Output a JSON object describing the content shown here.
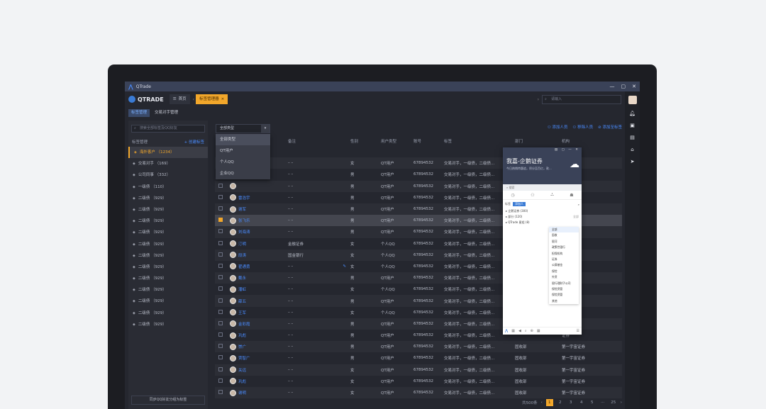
{
  "window": {
    "app_name": "QTrade",
    "brand": "QTRADE",
    "buttons": [
      "—",
      "▢",
      "✕"
    ]
  },
  "top": {
    "tabs": [
      {
        "label": "首页",
        "icon": "menu-icon"
      },
      {
        "label": "标签管理器",
        "close": "×"
      }
    ],
    "search_placeholder": "请输入"
  },
  "subtabs": [
    "标签管理",
    "交易对手管理"
  ],
  "sidebar": {
    "search_placeholder": "搜索全部标签及QQ好友",
    "header": "标签管理",
    "add_label": "+ 创建标签",
    "items": [
      "海外客户 （1234）",
      "交易对手 （169）",
      "公司同事 （332）",
      "一级债 （110）",
      "二级债 （929）",
      "二级债 （929）",
      "二级债 （929）",
      "二级债 （929）",
      "二级债 （929）",
      "二级债 （929）",
      "二级债 （929）",
      "二级债 （929）",
      "二级债 （929）",
      "二级债 （929）",
      "二级债 （929）",
      "二级债 （929）"
    ],
    "footer": "同步QQ好友分组为标签"
  },
  "filter": {
    "value": "全部类型",
    "options": [
      "全部类型",
      "QT用户",
      "个人QQ",
      "企业QQ"
    ]
  },
  "actions": [
    "添加人员",
    "移除人员",
    "添加至标签"
  ],
  "columns": [
    "",
    "",
    "备注",
    "性别",
    "用户类型",
    "账号",
    "标签",
    "部门",
    "机构"
  ],
  "rows": [
    {
      "name": "",
      "note": "",
      "sex": "",
      "src": "",
      "acct": "",
      "tags": "",
      "dept": "",
      "org": ""
    },
    {
      "name": "",
      "note": "– –",
      "sex": "女",
      "src": "QT用户",
      "acct": "67894532",
      "tags": "交易对手，一级债，二级债...",
      "dept": "",
      "org": ""
    },
    {
      "name": "",
      "note": "– –",
      "sex": "男",
      "src": "QT用户",
      "acct": "67894532",
      "tags": "交易对手，一级债，二级债...",
      "dept": "",
      "org": ""
    },
    {
      "name": "",
      "note": "– –",
      "sex": "男",
      "src": "QT用户",
      "acct": "67894532",
      "tags": "交易对手，一级债，二级债...",
      "dept": "",
      "org": ""
    },
    {
      "name": "雷浩宇",
      "note": "– –",
      "sex": "男",
      "src": "QT用户",
      "acct": "67894532",
      "tags": "交易对手，一级债，二级债...",
      "dept": "",
      "org": "证券"
    },
    {
      "name": "谢军",
      "note": "– –",
      "sex": "男",
      "src": "QT用户",
      "acct": "67894532",
      "tags": "交易对手，一级债，二级债...",
      "dept": "",
      "org": "证券"
    },
    {
      "name": "张飞乐",
      "note": "– –",
      "sex": "男",
      "src": "QT用户",
      "acct": "67894532",
      "tags": "交易对手，一级债，二级债...",
      "dept": "",
      "org": "证券",
      "checked": true
    },
    {
      "name": "刘海涛",
      "note": "– –",
      "sex": "男",
      "src": "QT用户",
      "acct": "67894532",
      "tags": "交易对手，一级债，二级债...",
      "dept": "",
      "org": "证券"
    },
    {
      "name": "汀明",
      "note": "金融证券",
      "sex": "女",
      "src": "个人QQ",
      "acct": "67894532",
      "tags": "交易对手，一级债，二级债...",
      "dept": "",
      "org": ""
    },
    {
      "name": "段涛",
      "note": "国金银行",
      "sex": "女",
      "src": "个人QQ",
      "acct": "67894532",
      "tags": "交易对手，一级债，二级债...",
      "dept": "",
      "org": ""
    },
    {
      "name": "翟通勇",
      "note": "– –",
      "sex": "女",
      "src": "个人QQ",
      "acct": "67894532",
      "tags": "交易对手，一级债，二级债...",
      "dept": "",
      "org": "证券",
      "edit": true
    },
    {
      "name": "戴永",
      "note": "– –",
      "sex": "男",
      "src": "QT用户",
      "acct": "67894532",
      "tags": "交易对手，一级债，二级债...",
      "dept": "",
      "org": "证券"
    },
    {
      "name": "潘虹",
      "note": "– –",
      "sex": "女",
      "src": "个人QQ",
      "acct": "67894532",
      "tags": "交易对手，一级债，二级债...",
      "dept": "",
      "org": ""
    },
    {
      "name": "薛五",
      "note": "– –",
      "sex": "男",
      "src": "QT用户",
      "acct": "67894532",
      "tags": "交易对手，一级债，二级债...",
      "dept": "",
      "org": "证券"
    },
    {
      "name": "王军",
      "note": "– –",
      "sex": "女",
      "src": "个人QQ",
      "acct": "67894532",
      "tags": "交易对手，一级债，二级债...",
      "dept": "",
      "org": ""
    },
    {
      "name": "金彩霞",
      "note": "– –",
      "sex": "男",
      "src": "QT用户",
      "acct": "67894532",
      "tags": "交易对手，一级债，二级债...",
      "dept": "",
      "org": "证券"
    },
    {
      "name": "巩彪",
      "note": "– –",
      "sex": "男",
      "src": "QT用户",
      "acct": "67894532",
      "tags": "交易对手，一级债，二级债...",
      "dept": "",
      "org": "证券"
    },
    {
      "name": "崇广",
      "note": "– –",
      "sex": "男",
      "src": "QT用户",
      "acct": "67894532",
      "tags": "交易对手，一级债，二级债...",
      "dept": "固收部",
      "org": "第一宇宙证券"
    },
    {
      "name": "贾智广",
      "note": "– –",
      "sex": "男",
      "src": "QT用户",
      "acct": "67894532",
      "tags": "交易对手，一级债，二级债...",
      "dept": "固收部",
      "org": "第一宇宙证券"
    },
    {
      "name": "关远",
      "note": "– –",
      "sex": "女",
      "src": "QT用户",
      "acct": "67894532",
      "tags": "交易对手，一级债，二级债...",
      "dept": "固收部",
      "org": "第一宇宙证券"
    },
    {
      "name": "巩彪",
      "note": "– –",
      "sex": "女",
      "src": "QT用户",
      "acct": "67894532",
      "tags": "交易对手，一级债，二级债...",
      "dept": "固收部",
      "org": "第一宇宙证券"
    },
    {
      "name": "谢明",
      "note": "– –",
      "sex": "女",
      "src": "QT用户",
      "acct": "67894532",
      "tags": "交易对手，一级债，二级债...",
      "dept": "固收部",
      "org": "第一宇宙证券"
    }
  ],
  "pager": {
    "total": "共500条",
    "pages": [
      "1",
      "2",
      "3",
      "4",
      "5",
      "···",
      "25"
    ],
    "prev": "‹",
    "next": "›"
  },
  "popup": {
    "title": "我嘉-企鹅证券",
    "subtitle": "今日热销特惠追，积分至百亿，款...",
    "search": "搜索",
    "chip_left": "标签",
    "chip": "添加人",
    "tree": [
      "▸ 企鹅证券 (300)",
      "▸ 部分 (120)",
      "▸ QTrade 星组 (8)"
    ],
    "tree_right": "全部",
    "submenu": [
      "全部",
      "固收",
      "银河",
      "政策性银行",
      "担保机构",
      "证券",
      "公募基金",
      "保险",
      "外资",
      "银行理财子公司",
      "保险资管",
      "保险资管",
      "其他"
    ]
  }
}
